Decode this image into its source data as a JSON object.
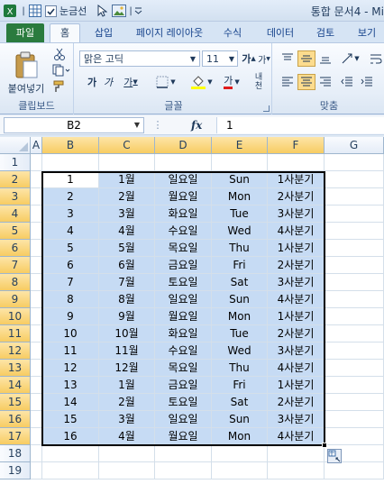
{
  "title_bar": {
    "title": "통합 문서4 - Mi",
    "gridlines_label": "눈금선"
  },
  "tabs": [
    "파일",
    "홈",
    "삽입",
    "페이지 레이아웃",
    "수식",
    "데이터",
    "검토",
    "보기"
  ],
  "active_tab": "홈",
  "ribbon": {
    "clipboard": {
      "paste_label": "붙여넣기",
      "group_label": "클립보드"
    },
    "font": {
      "font_name": "맑은 고딕",
      "font_size": "11",
      "group_label": "글꼴"
    },
    "alignment": {
      "group_label": "맞춤"
    }
  },
  "formula_bar": {
    "name_box": "B2",
    "fx_label": "fx",
    "formula": "1"
  },
  "columns": [
    "A",
    "B",
    "C",
    "D",
    "E",
    "F",
    "G"
  ],
  "selected_columns": [
    "B",
    "C",
    "D",
    "E",
    "F"
  ],
  "row_numbers": [
    "1",
    "2",
    "3",
    "4",
    "5",
    "6",
    "7",
    "8",
    "9",
    "10",
    "11",
    "12",
    "13",
    "14",
    "15",
    "16",
    "17",
    "18",
    "19"
  ],
  "selected_rows": [
    "2",
    "3",
    "4",
    "5",
    "6",
    "7",
    "8",
    "9",
    "10",
    "11",
    "12",
    "13",
    "14",
    "15",
    "16",
    "17"
  ],
  "selection_range": "B2:F17",
  "rows": [
    [
      "1",
      "1월",
      "일요일",
      "Sun",
      "1사분기"
    ],
    [
      "2",
      "2월",
      "월요일",
      "Mon",
      "2사분기"
    ],
    [
      "3",
      "3월",
      "화요일",
      "Tue",
      "3사분기"
    ],
    [
      "4",
      "4월",
      "수요일",
      "Wed",
      "4사분기"
    ],
    [
      "5",
      "5월",
      "목요일",
      "Thu",
      "1사분기"
    ],
    [
      "6",
      "6월",
      "금요일",
      "Fri",
      "2사분기"
    ],
    [
      "7",
      "7월",
      "토요일",
      "Sat",
      "3사분기"
    ],
    [
      "8",
      "8월",
      "일요일",
      "Sun",
      "4사분기"
    ],
    [
      "9",
      "9월",
      "월요일",
      "Mon",
      "1사분기"
    ],
    [
      "10",
      "10월",
      "화요일",
      "Tue",
      "2사분기"
    ],
    [
      "11",
      "11월",
      "수요일",
      "Wed",
      "3사분기"
    ],
    [
      "12",
      "12월",
      "목요일",
      "Thu",
      "4사분기"
    ],
    [
      "13",
      "1월",
      "금요일",
      "Fri",
      "1사분기"
    ],
    [
      "14",
      "2월",
      "토요일",
      "Sat",
      "2사분기"
    ],
    [
      "15",
      "3월",
      "일요일",
      "Sun",
      "3사분기"
    ],
    [
      "16",
      "4월",
      "월요일",
      "Mon",
      "4사분기"
    ]
  ],
  "colors": {
    "file_tab": "#2a7b3e",
    "selection_fill": "#c6dbf4",
    "header_highlight": "#f7cc62"
  }
}
